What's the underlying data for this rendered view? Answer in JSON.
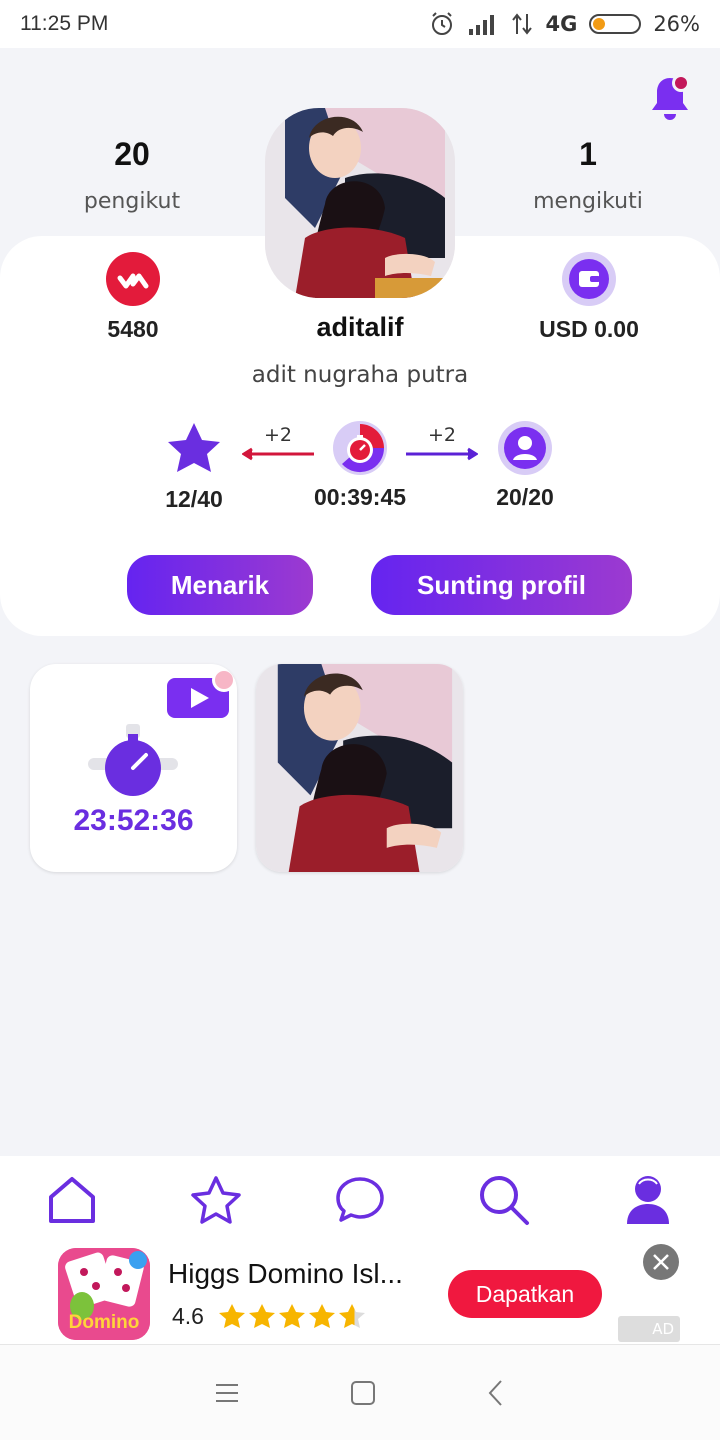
{
  "status_bar": {
    "time": "11:25 PM",
    "network": "4G",
    "battery_percent": "26%",
    "battery_level": 0.26,
    "icons": [
      "alarm-icon",
      "signal-icon",
      "data-arrows-icon",
      "battery-icon"
    ]
  },
  "profile": {
    "followers_count": "20",
    "followers_label": "pengikut",
    "following_count": "1",
    "following_label": "mengikuti",
    "points": "5480",
    "wallet_balance": "USD 0.00",
    "username": "aditalif",
    "display_name": "adit nugraha putra"
  },
  "progress": {
    "stars": "12/40",
    "timer": "00:39:45",
    "friends": "20/20",
    "left_bonus": "+2",
    "right_bonus": "+2"
  },
  "actions": {
    "withdraw_label": "Menarik",
    "edit_profile_label": "Sunting profil"
  },
  "posts": {
    "countdown": "23:52:36"
  },
  "bottom_nav": {
    "items": [
      "home-icon",
      "star-icon",
      "chat-icon",
      "search-icon",
      "profile-icon"
    ],
    "active": "profile-icon"
  },
  "ad": {
    "title": "Higgs Domino Isl...",
    "rating": "4.6",
    "rating_value": 4.6,
    "cta": "Dapatkan",
    "badge": "AD",
    "icon_text": "Domino"
  },
  "colors": {
    "accent": "#6524f0",
    "accent_end": "#9c3ad0",
    "red_badge": "#e31b3b",
    "ad_button": "#f0183f"
  }
}
